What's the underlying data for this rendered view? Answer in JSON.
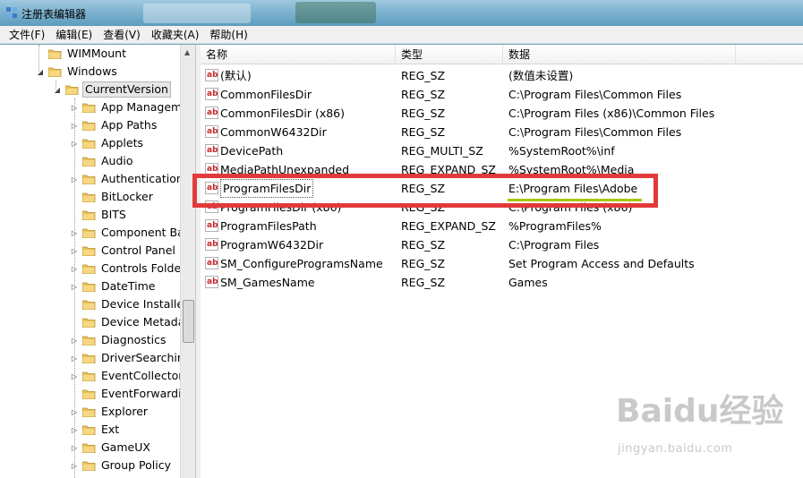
{
  "window": {
    "title": "注册表编辑器"
  },
  "menubar": [
    {
      "label": "文件(F)"
    },
    {
      "label": "编辑(E)"
    },
    {
      "label": "查看(V)"
    },
    {
      "label": "收藏夹(A)"
    },
    {
      "label": "帮助(H)"
    }
  ],
  "tree": {
    "items": [
      {
        "label": "WIMMount",
        "expander": ""
      },
      {
        "label": "Windows",
        "expander": "◢"
      },
      {
        "label": "CurrentVersion",
        "expander": "◢",
        "selected": true
      },
      {
        "label": "App Manageme",
        "expander": "▷"
      },
      {
        "label": "App Paths",
        "expander": "▷"
      },
      {
        "label": "Applets",
        "expander": "▷"
      },
      {
        "label": "Audio",
        "expander": ""
      },
      {
        "label": "Authentication",
        "expander": "▷"
      },
      {
        "label": "BitLocker",
        "expander": ""
      },
      {
        "label": "BITS",
        "expander": ""
      },
      {
        "label": "Component Bas",
        "expander": "▷"
      },
      {
        "label": "Control Panel",
        "expander": "▷"
      },
      {
        "label": "Controls Folder",
        "expander": "▷"
      },
      {
        "label": "DateTime",
        "expander": "▷"
      },
      {
        "label": "Device Installer",
        "expander": ""
      },
      {
        "label": "Device Metadat",
        "expander": ""
      },
      {
        "label": "Diagnostics",
        "expander": "▷"
      },
      {
        "label": "DriverSearching",
        "expander": "▷"
      },
      {
        "label": "EventCollector",
        "expander": "▷"
      },
      {
        "label": "EventForwardin",
        "expander": ""
      },
      {
        "label": "Explorer",
        "expander": "▷"
      },
      {
        "label": "Ext",
        "expander": "▷"
      },
      {
        "label": "GameUX",
        "expander": "▷"
      },
      {
        "label": "Group Policy",
        "expander": "▷"
      }
    ]
  },
  "list": {
    "columns": [
      "名称",
      "类型",
      "数据"
    ],
    "rows": [
      {
        "name": "(默认)",
        "type": "REG_SZ",
        "data": "(数值未设置)"
      },
      {
        "name": "CommonFilesDir",
        "type": "REG_SZ",
        "data": "C:\\Program Files\\Common Files"
      },
      {
        "name": "CommonFilesDir (x86)",
        "type": "REG_SZ",
        "data": "C:\\Program Files (x86)\\Common Files"
      },
      {
        "name": "CommonW6432Dir",
        "type": "REG_SZ",
        "data": "C:\\Program Files\\Common Files"
      },
      {
        "name": "DevicePath",
        "type": "REG_MULTI_SZ",
        "data": "%SystemRoot%\\inf"
      },
      {
        "name": "MediaPathUnexpanded",
        "type": "REG_EXPAND_SZ",
        "data": "%SystemRoot%\\Media"
      },
      {
        "name": "ProgramFilesDir",
        "type": "REG_SZ",
        "data": "E:\\Program Files\\Adobe",
        "selected": true
      },
      {
        "name": "ProgramFilesDir (x86)",
        "type": "REG_SZ",
        "data": "C:\\Program Files (x86)"
      },
      {
        "name": "ProgramFilesPath",
        "type": "REG_EXPAND_SZ",
        "data": "%ProgramFiles%"
      },
      {
        "name": "ProgramW6432Dir",
        "type": "REG_SZ",
        "data": "C:\\Program Files"
      },
      {
        "name": "SM_ConfigureProgramsName",
        "type": "REG_SZ",
        "data": "Set Program Access and Defaults"
      },
      {
        "name": "SM_GamesName",
        "type": "REG_SZ",
        "data": "Games"
      }
    ]
  },
  "watermark": {
    "logo": "Baidu经验",
    "url": "jingyan.baidu.com"
  },
  "colors": {
    "highlight_box": "#e23a3a",
    "underline": "#a5c800",
    "folder": "#e9c25b"
  }
}
